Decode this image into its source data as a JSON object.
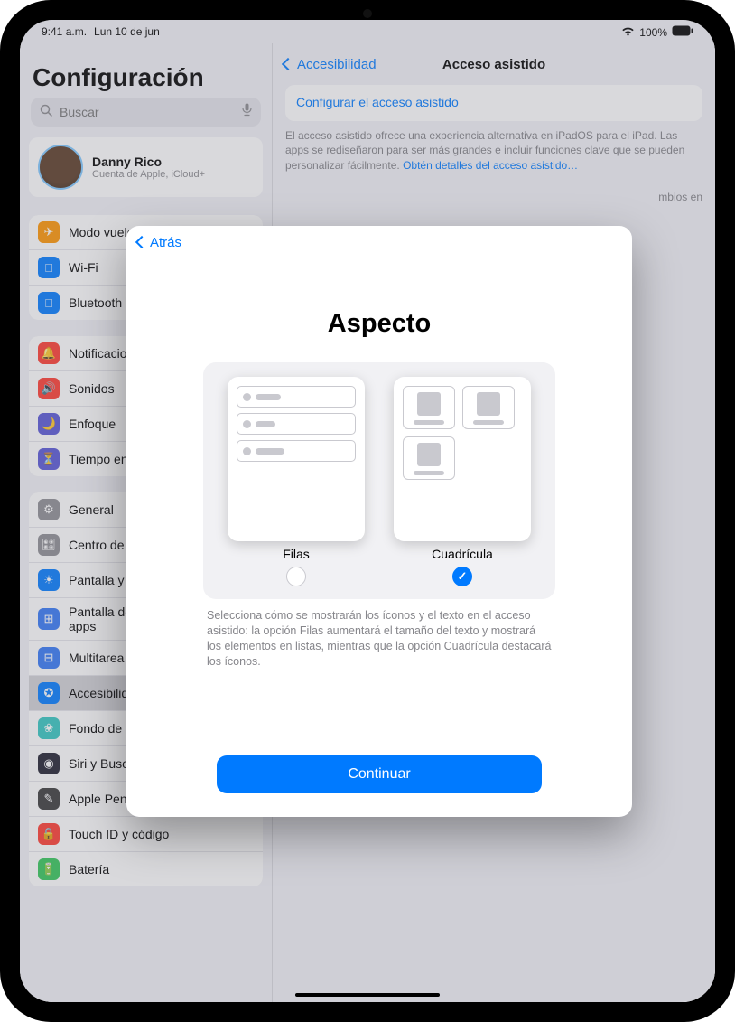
{
  "status": {
    "time": "9:41 a.m.",
    "date": "Lun 10 de jun",
    "wifi": "􀙇",
    "battery_pct": "100%"
  },
  "sidebar": {
    "title": "Configuración",
    "search_placeholder": "Buscar",
    "profile": {
      "name": "Danny Rico",
      "sub": "Cuenta de Apple, iCloud+"
    },
    "g1": [
      {
        "icon": "✈︎",
        "color": "#ff9500",
        "label": "Modo vuelo"
      },
      {
        "icon": "􀙇",
        "color": "#007aff",
        "label": "Wi-Fi"
      },
      {
        "icon": "􀉤",
        "color": "#007aff",
        "label": "Bluetooth"
      }
    ],
    "g2": [
      {
        "icon": "🔔",
        "color": "#ff3b30",
        "label": "Notificaciones"
      },
      {
        "icon": "🔊",
        "color": "#ff3b30",
        "label": "Sonidos"
      },
      {
        "icon": "🌙",
        "color": "#5856d6",
        "label": "Enfoque"
      },
      {
        "icon": "⏳",
        "color": "#5856d6",
        "label": "Tiempo en pantalla"
      }
    ],
    "g3": [
      {
        "icon": "⚙︎",
        "color": "#8e8e93",
        "label": "General"
      },
      {
        "icon": "🎛",
        "color": "#8e8e93",
        "label": "Centro de control"
      },
      {
        "icon": "☀︎",
        "color": "#007aff",
        "label": "Pantalla y brillo"
      },
      {
        "icon": "⊞",
        "color": "#3478f6",
        "label": "Pantalla de inicio y biblioteca de apps"
      },
      {
        "icon": "⊟",
        "color": "#3478f6",
        "label": "Multitarea y gestos"
      },
      {
        "icon": "✪",
        "color": "#007aff",
        "label": "Accesibilidad",
        "selected": true
      },
      {
        "icon": "❀",
        "color": "#34c7c1",
        "label": "Fondo de pantalla"
      },
      {
        "icon": "◉",
        "color": "#1f1f2e",
        "label": "Siri y Buscar"
      },
      {
        "icon": "✎",
        "color": "#393939",
        "label": "Apple Pencil"
      },
      {
        "icon": "🔒",
        "color": "#ff3b30",
        "label": "Touch ID y código"
      },
      {
        "icon": "🔋",
        "color": "#34c759",
        "label": "Batería"
      }
    ]
  },
  "detail": {
    "back": "Accesibilidad",
    "title": "Acceso asistido",
    "card": "Configurar el acceso asistido",
    "desc": "El acceso asistido ofrece una experiencia alternativa en iPadOS para el iPad. Las apps se rediseñaron para ser más grandes e incluir funciones clave que se pueden personalizar fácilmente. ",
    "link": "Obtén detalles del acceso asistido…",
    "desc2_a": "mbios en"
  },
  "modal": {
    "back": "Atrás",
    "title": "Aspecto",
    "option1": {
      "label": "Filas",
      "selected": false
    },
    "option2": {
      "label": "Cuadrícula",
      "selected": true
    },
    "desc": "Selecciona cómo se mostrarán los íconos y el texto en el acceso asistido: la opción Filas aumentará el tamaño del texto y mostrará los elementos en listas, mientras que la opción Cuadrícula destacará los íconos.",
    "continue": "Continuar"
  }
}
